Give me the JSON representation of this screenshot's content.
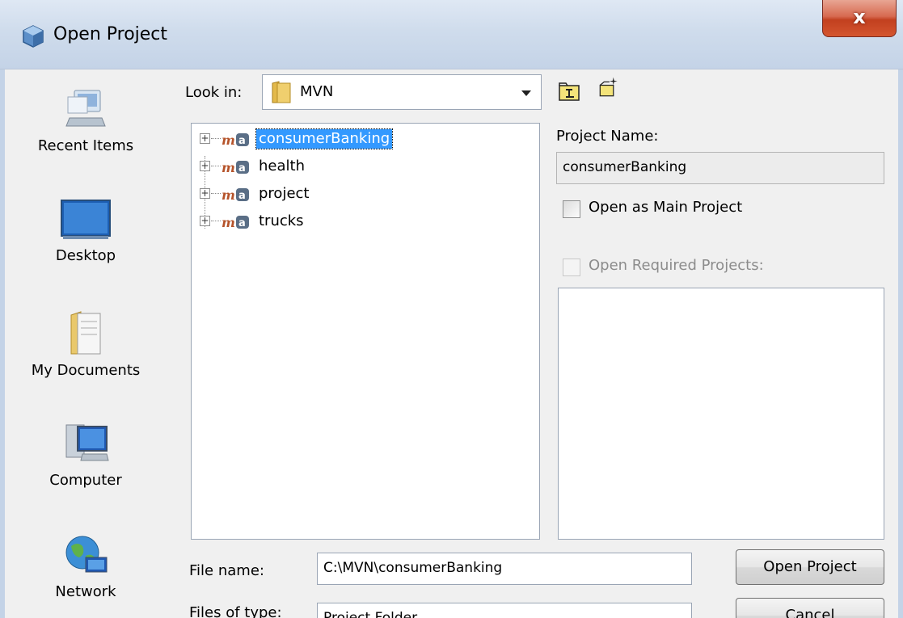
{
  "window": {
    "title": "Open Project",
    "close_label": "x"
  },
  "places": [
    {
      "label": "Recent Items",
      "icon": "recent-items-icon"
    },
    {
      "label": "Desktop",
      "icon": "desktop-icon"
    },
    {
      "label": "My Documents",
      "icon": "my-documents-icon"
    },
    {
      "label": "Computer",
      "icon": "computer-icon"
    },
    {
      "label": "Network",
      "icon": "network-icon"
    }
  ],
  "lookin": {
    "label": "Look in:",
    "value": "MVN"
  },
  "toolbar": {
    "up_icon": "up-one-level-icon",
    "new_folder_icon": "new-folder-icon"
  },
  "tree": {
    "items": [
      {
        "label": "consumerBanking",
        "selected": true
      },
      {
        "label": "health",
        "selected": false
      },
      {
        "label": "project",
        "selected": false
      },
      {
        "label": "trucks",
        "selected": false
      }
    ]
  },
  "project": {
    "name_label": "Project Name:",
    "name_value": "consumerBanking",
    "main_label": "Open as Main Project",
    "required_label": "Open Required Projects:"
  },
  "file": {
    "name_label": "File name:",
    "name_value": "C:\\MVN\\consumerBanking",
    "type_label": "Files of type:",
    "type_value": "Project Folder"
  },
  "buttons": {
    "open": "Open Project",
    "cancel": "Cancel"
  },
  "colors": {
    "selection": "#3399ff",
    "close_button": "#c2401f"
  }
}
